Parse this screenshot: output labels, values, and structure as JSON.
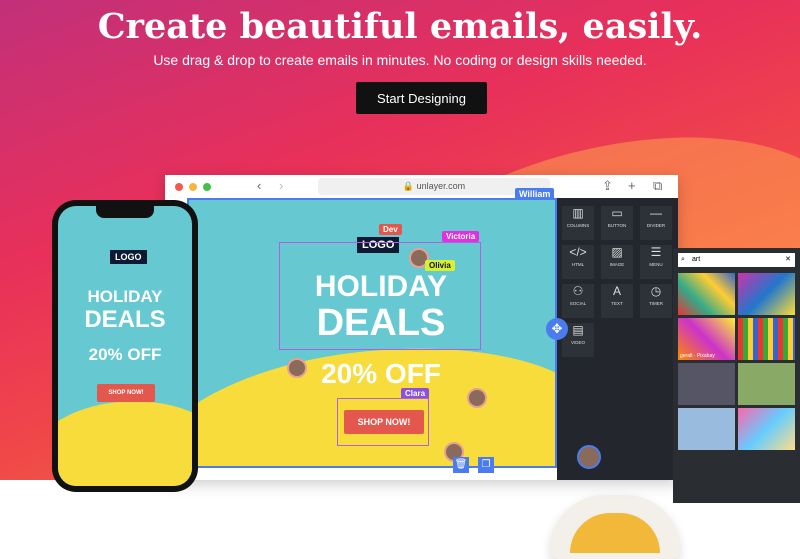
{
  "hero": {
    "title": "Create beautiful emails, easily.",
    "subtitle": "Use drag & drop to create emails in minutes. No coding or design skills needed.",
    "cta": "Start Designing"
  },
  "browser": {
    "url": "unlayer.com"
  },
  "collaborators": [
    "William",
    "Dev",
    "Victoria",
    "Olivia",
    "Clara"
  ],
  "email": {
    "logo": "LOGO",
    "line1": "HOLIDAY",
    "line2": "DEALS",
    "offer": "20% OFF",
    "button": "SHOP NOW!"
  },
  "tools": [
    "COLUMNS",
    "BUTTON",
    "DIVIDER",
    "HTML",
    "IMAGE",
    "MENU",
    "SOCIAL",
    "TEXT",
    "TIMER",
    "VIDEO"
  ],
  "tool_icons": [
    "columns-icon",
    "button-icon",
    "divider-icon",
    "code-icon",
    "image-icon",
    "menu-icon",
    "social-icon",
    "text-icon",
    "timer-icon",
    "video-icon"
  ],
  "image_search": {
    "value": "art",
    "caption": "geralt · Pixabay"
  },
  "colors": {
    "accent": "#4a7cf0",
    "teal": "#66c8d0",
    "yellow": "#f8dc3c",
    "cta": "#e4574d"
  }
}
